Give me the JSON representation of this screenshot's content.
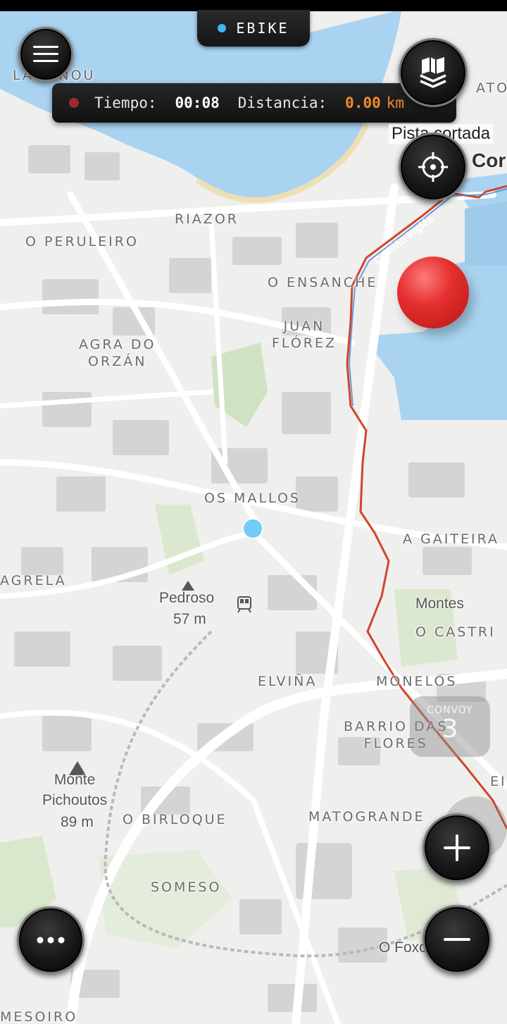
{
  "app": {
    "mode_label": "EBIKE",
    "mode_color": "#3fb6f0"
  },
  "trip": {
    "time_label": "Tiempo:",
    "time_value": "00:08",
    "distance_label": "Distancia:",
    "distance_value": "0.00",
    "distance_unit": "km",
    "recording_color": "#9b2b2b",
    "accent_color": "#f08a2e"
  },
  "controls": {
    "menu_icon": "hamburger-menu-icon",
    "layers_icon": "map-layers-icon",
    "locate_icon": "crosshair-locate-icon",
    "more_icon": "more-dots-icon",
    "zoom_in_icon": "plus-icon",
    "zoom_out_icon": "minus-icon"
  },
  "track_label": "Pista cortada",
  "convoy": {
    "title": "CONVOY",
    "count": "3"
  },
  "map": {
    "places": {
      "lagonou": "LAGONOU",
      "atocha": "ATOC",
      "riazor": "RIAZOR",
      "o_peruleiro": "O PERULEIRO",
      "o_ensanche": "O ENSANCHE",
      "juan_florez": "JUAN\nFLÓREZ",
      "agra_do_orzan": "AGRA DO\nORZÁN",
      "os_mallos": "OS MALLOS",
      "a_gaiteira": "A GAITEIRA",
      "agrela": "AGRELA",
      "o_castrillon": "O CASTRI",
      "elvina": "ELVIÑA",
      "monelos": "MONELOS",
      "barrio_das_flores": "BARRIO DAS\nFLORES",
      "o_birloque": "O BIRLOQUE",
      "matogrande": "MATOGRANDE",
      "someso": "SOMESO",
      "mesoiro": "MESOIRO",
      "eirís": "EI"
    },
    "pois": {
      "pedroso_name": "Pedroso",
      "pedroso_elev": "57 m",
      "monte_pichoutos_name": "Monte\nPichoutos",
      "monte_pichoutos_elev": "89 m",
      "montes": "Montes",
      "o_foxo": "O Foxo",
      "coruna_partial": "Coru"
    },
    "road_label": "Camiño Inglés",
    "route_color": "#d0452c",
    "water_color": "#a9d3f0",
    "marker_color": "#e53030",
    "user_dot_color": "#71cdf4"
  }
}
